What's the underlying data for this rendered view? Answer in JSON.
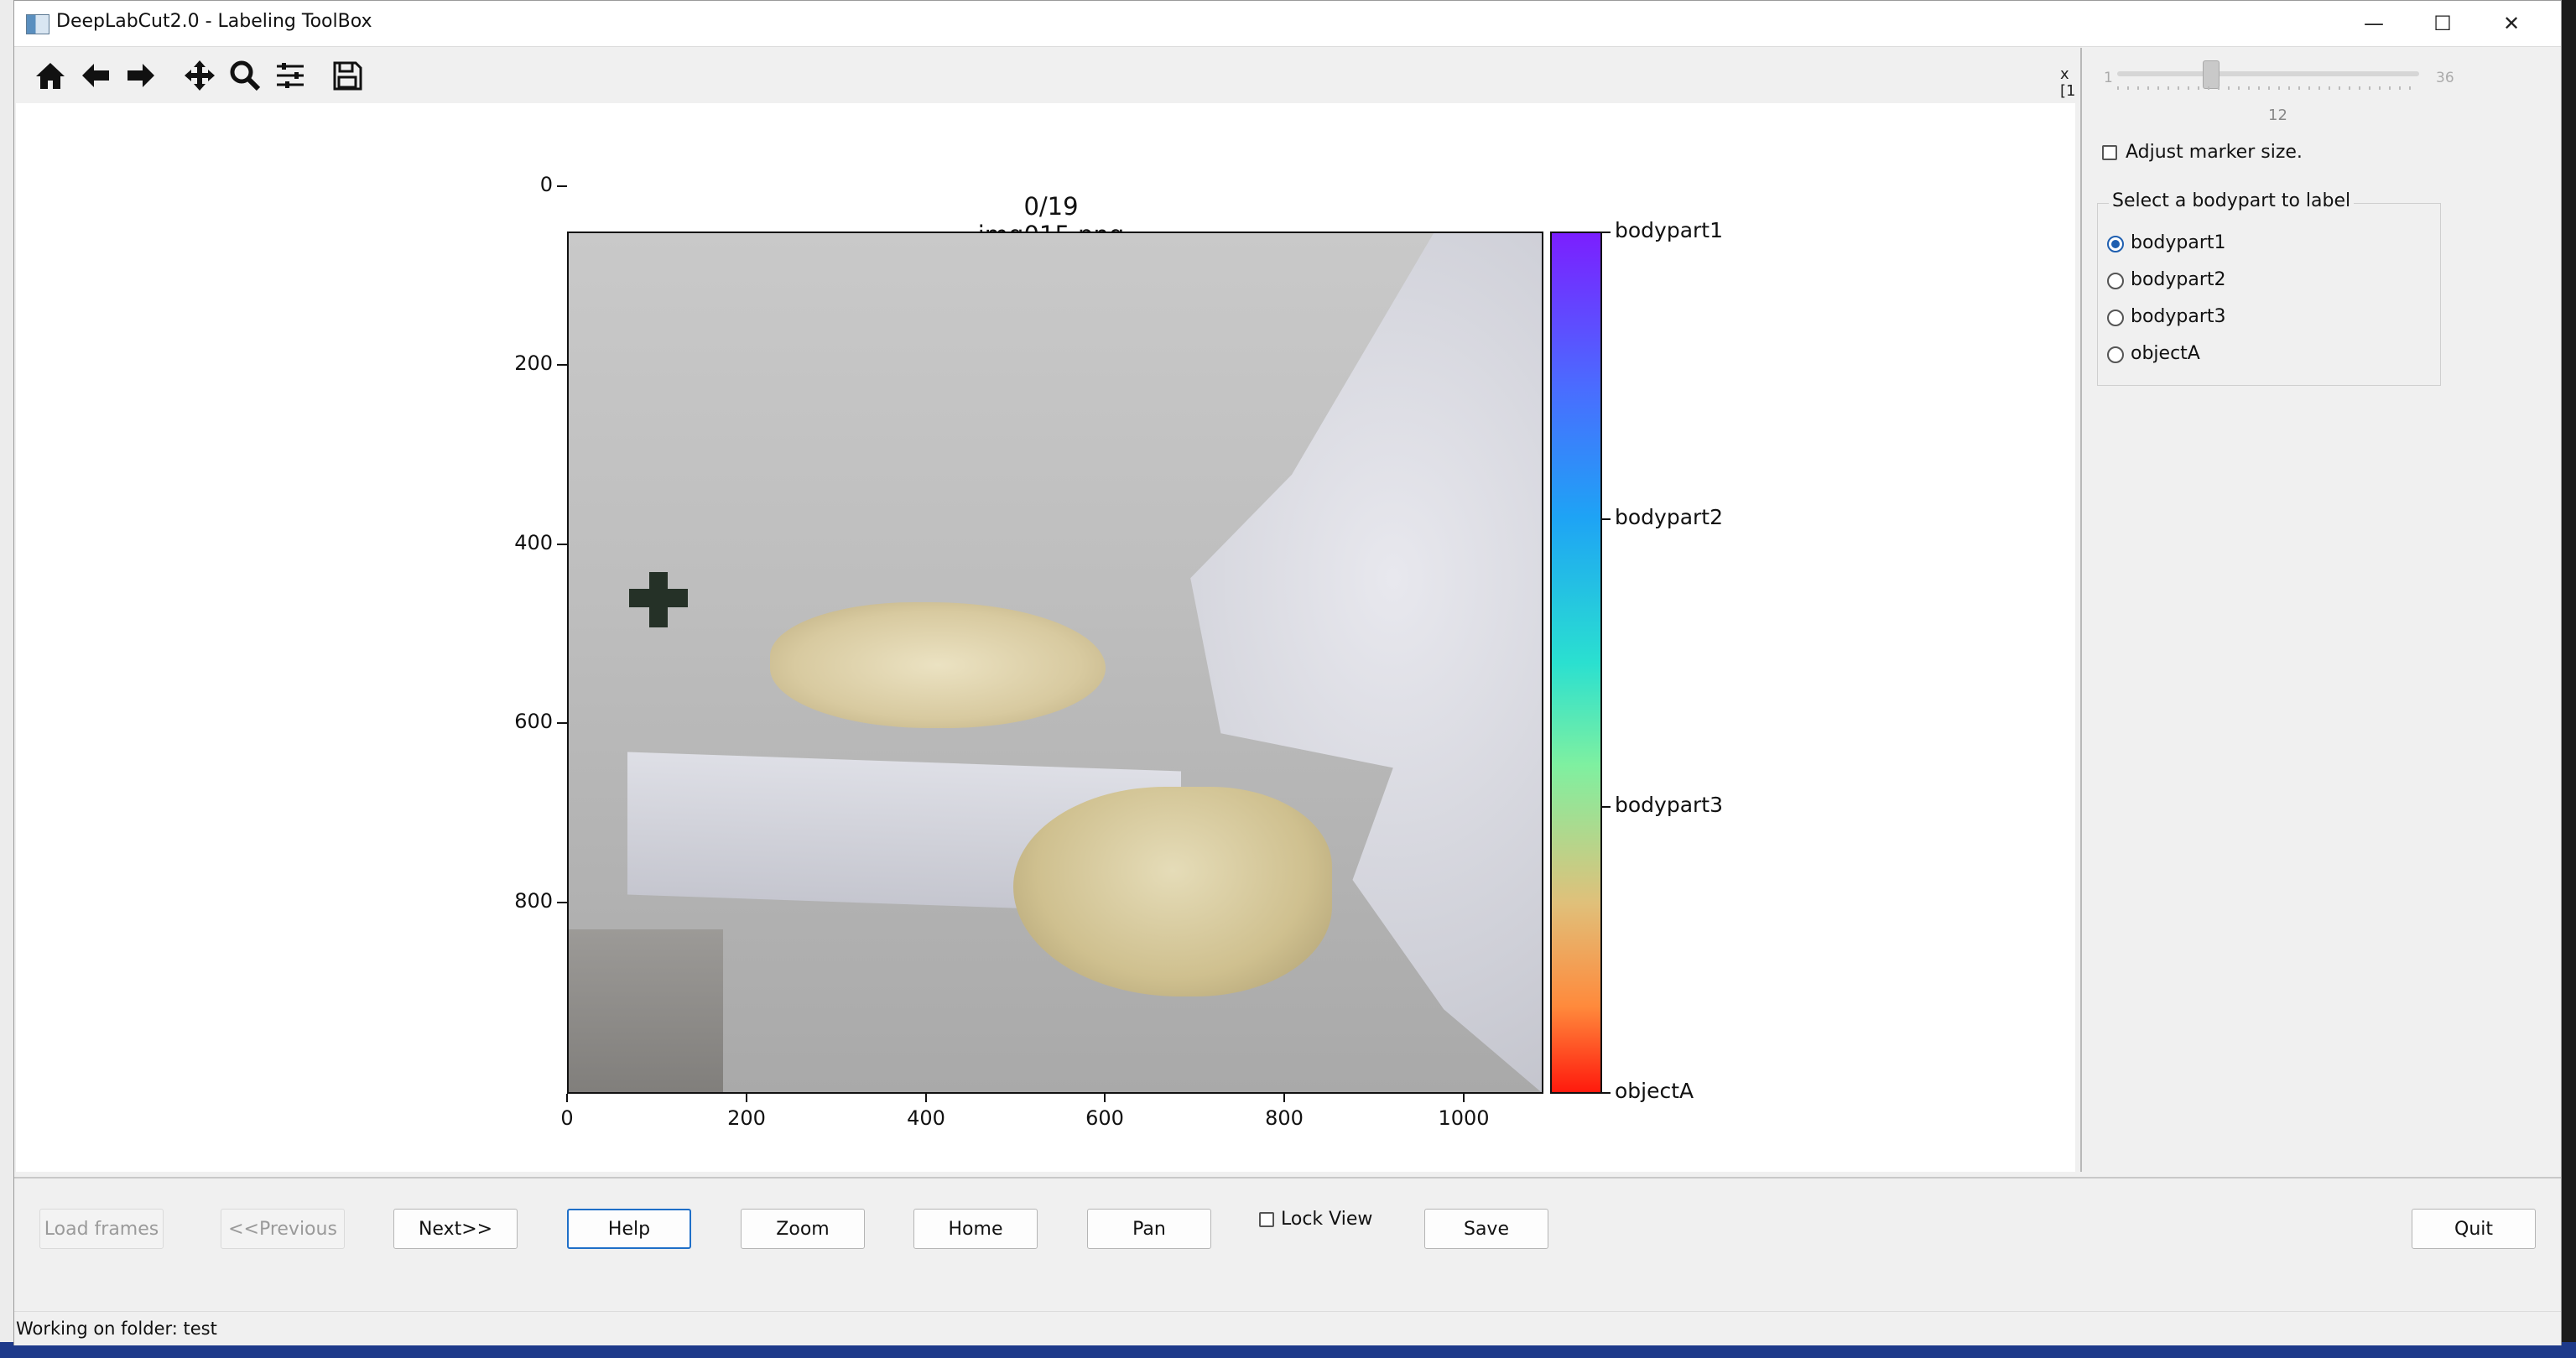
{
  "window": {
    "title": "DeepLabCut2.0 - Labeling ToolBox",
    "controls": [
      "—",
      "☐",
      "✕"
    ]
  },
  "toolbar": {
    "icons": [
      "home-icon",
      "back-arrow-icon",
      "forward-arrow-icon",
      "pan-move-icon",
      "zoom-magnifier-icon",
      "configure-subplots-icon",
      "save-disk-icon"
    ],
    "coords_text": "x\n[1"
  },
  "plot": {
    "title": "0/19 img015.png",
    "x_ticks": [
      "0",
      "200",
      "400",
      "600",
      "800",
      "1000"
    ],
    "y_ticks": [
      "0",
      "200",
      "400",
      "600",
      "800"
    ],
    "colorbar_labels": [
      "bodypart1",
      "bodypart2",
      "bodypart3",
      "objectA"
    ]
  },
  "chart_data": {
    "type": "image",
    "title": "0/19 img015.png",
    "xlim": [
      0,
      1090
    ],
    "ylim": [
      965,
      0
    ],
    "x_ticks": [
      0,
      200,
      400,
      600,
      800,
      1000
    ],
    "y_ticks": [
      0,
      200,
      400,
      600,
      800
    ],
    "colorbar": {
      "categories": [
        "bodypart1",
        "bodypart2",
        "bodypart3",
        "objectA"
      ],
      "colormap": [
        "#7b1fff",
        "#4a6cff",
        "#1ea3f5",
        "#2ae0d0",
        "#7ff0a0",
        "#e0c07a",
        "#ff8a3c",
        "#ff1a0d"
      ]
    }
  },
  "marker_panel": {
    "slider_min": "1",
    "slider_max": "36",
    "slider_value": "12",
    "slider_fraction": 0.314,
    "adjust_label": "Adjust marker size.",
    "adjust_checked": false,
    "group_title": "Select a bodypart to label",
    "bodyparts": [
      {
        "label": "bodypart1",
        "selected": true
      },
      {
        "label": "bodypart2",
        "selected": false
      },
      {
        "label": "bodypart3",
        "selected": false
      },
      {
        "label": "objectA",
        "selected": false
      }
    ]
  },
  "buttons": {
    "load": "Load frames",
    "previous": "<<Previous",
    "next": "Next>>",
    "help": "Help",
    "zoom": "Zoom",
    "home": "Home",
    "pan": "Pan",
    "lock_view": "Lock View",
    "save": "Save",
    "quit": "Quit"
  },
  "status": {
    "text": "Working on folder: test"
  },
  "colors": {
    "accent": "#1f6fc8",
    "radio_selected": "#1f5fb0"
  }
}
